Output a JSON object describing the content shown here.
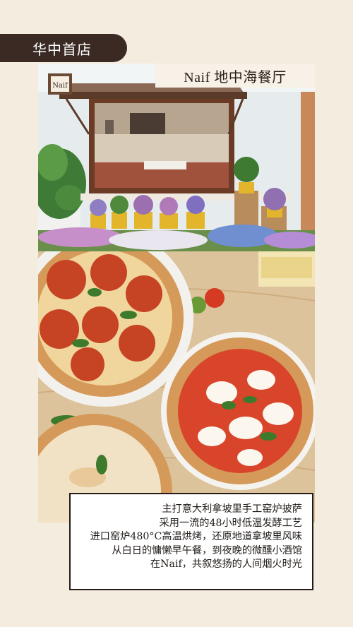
{
  "badge": {
    "label": "华中首店"
  },
  "restaurant": {
    "title": "Naif 地中海餐厅",
    "sign_text": "Naif"
  },
  "description": {
    "lines": [
      "主打意大利拿坡里手工窑炉披萨",
      "采用一流的48小时低温发酵工艺",
      "进口窑炉480°C高温烘烤，还原地道拿坡里风味",
      "从白日的慵懒早午餐，到夜晚的微醺小酒馆",
      "在Naif，共叙悠扬的人间烟火时光"
    ]
  },
  "colors": {
    "badge_bg": "#3b2a24",
    "page_bg": "#f3ecdf",
    "frame_border": "#231b17"
  }
}
